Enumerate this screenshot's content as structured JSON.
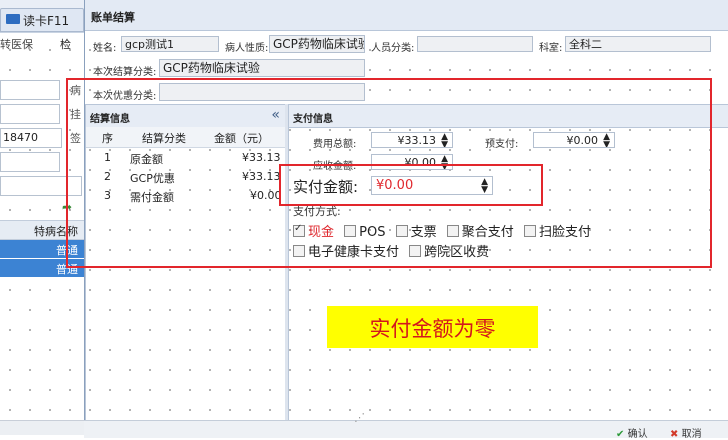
{
  "left_app": {
    "tab_label": "读卡F11",
    "medins_label": "转医保",
    "check_label": "检",
    "side_labels": [
      "病",
      "挂",
      "签"
    ],
    "field_value": "18470",
    "grid_header": "特病名称",
    "rows": [
      "普通",
      "普通"
    ]
  },
  "dialog": {
    "title": "账单结算",
    "name_label": "姓名:",
    "name_value": "gcp测试1",
    "patient_type_label": "病人性质:",
    "patient_type_value": "GCP药物临床试验",
    "staff_class_label": "人员分类:",
    "staff_class_value": "",
    "dept_label": "科室:",
    "dept_value": "全科二",
    "settle_class_label": "本次结算分类:",
    "settle_class_value": "GCP药物临床试验",
    "discount_class_label": "本次优惠分类:",
    "discount_class_value": ""
  },
  "settle_panel": {
    "title": "结算信息",
    "collapse_icon": "double-chevron-left",
    "columns": [
      "序",
      "结算分类",
      "金额（元）"
    ],
    "rows": [
      {
        "seq": "1",
        "category": "原金额",
        "amount": "¥33.13"
      },
      {
        "seq": "2",
        "category": "GCP优惠",
        "amount": "¥33.13"
      },
      {
        "seq": "3",
        "category": "需付金额",
        "amount": "¥0.00"
      }
    ]
  },
  "pay_panel": {
    "title": "支付信息",
    "total_label": "费用总额:",
    "total_value": "¥33.13",
    "prepay_label": "预支付:",
    "prepay_value": "¥0.00",
    "receivable_label": "应收金额:",
    "receivable_value": "¥0.00",
    "actual_label": "实付金额:",
    "actual_value": "¥0.00",
    "method_label": "支付方式:",
    "methods": [
      {
        "label": "现金",
        "checked": true,
        "color": "#e0282e"
      },
      {
        "label": "POS",
        "checked": false
      },
      {
        "label": "支票",
        "checked": false
      },
      {
        "label": "聚合支付",
        "checked": false
      },
      {
        "label": "扫脸支付",
        "checked": false
      },
      {
        "label": "电子健康卡支付",
        "checked": false
      },
      {
        "label": "跨院区收费",
        "checked": false
      }
    ]
  },
  "note": {
    "text": "实付金额为零",
    "bg_color": "#ffff00",
    "text_color": "#d4171c"
  },
  "buttons": {
    "confirm": "确认",
    "cancel": "取消"
  },
  "colors": {
    "annotation_red": "#e2262c",
    "selection_blue": "#3c83d3"
  }
}
